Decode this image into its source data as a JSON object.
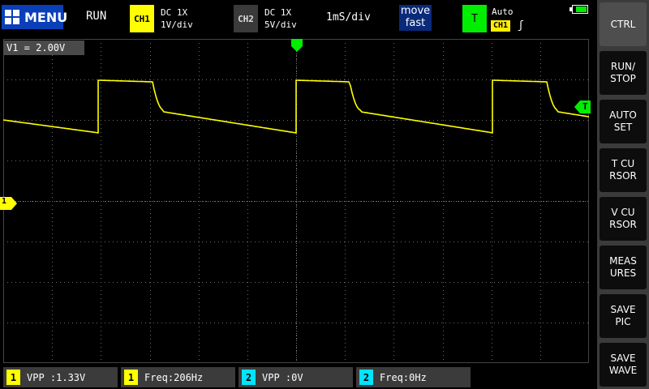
{
  "topbar": {
    "menu_label": "MENU",
    "run_state": "RUN",
    "ch1": {
      "tag": "CH1",
      "coupling": "DC  1X",
      "scale": "1V/div"
    },
    "ch2": {
      "tag": "CH2",
      "coupling": "DC  1X",
      "scale": "5V/div"
    },
    "timebase": "1mS/div",
    "move_mode": {
      "line1": "move",
      "line2": "fast"
    },
    "trigger": {
      "tag": "T",
      "mode": "Auto",
      "source": "CH1",
      "edge": "ʃ"
    },
    "colors": {
      "ch1": "#ffff00",
      "ch2": "#00e5ff",
      "trigger": "#00ee00",
      "menu": "#0a3fb8"
    }
  },
  "sidepanel": {
    "buttons": [
      {
        "id": "ctrl",
        "label": "CTRL"
      },
      {
        "id": "run-stop",
        "label": "RUN/\nSTOP"
      },
      {
        "id": "auto-set",
        "label": "AUTO\nSET"
      },
      {
        "id": "t-cursor",
        "label": "T CU\nRSOR"
      },
      {
        "id": "v-cursor",
        "label": "V CU\nRSOR"
      },
      {
        "id": "measures",
        "label": "MEAS\nURES"
      },
      {
        "id": "save-pic",
        "label": "SAVE\nPIC"
      },
      {
        "id": "save-wave",
        "label": "SAVE\nWAVE"
      }
    ]
  },
  "plot": {
    "v1_readout": "V1 = 2.00V",
    "ch1_marker": "1",
    "trigger_level_marker": "T"
  },
  "measurements": [
    {
      "channel": "1",
      "text": "VPP :1.33V"
    },
    {
      "channel": "1",
      "text": "Freq:206Hz"
    },
    {
      "channel": "2",
      "text": "VPP :0V"
    },
    {
      "channel": "2",
      "text": "Freq:0Hz"
    }
  ]
}
